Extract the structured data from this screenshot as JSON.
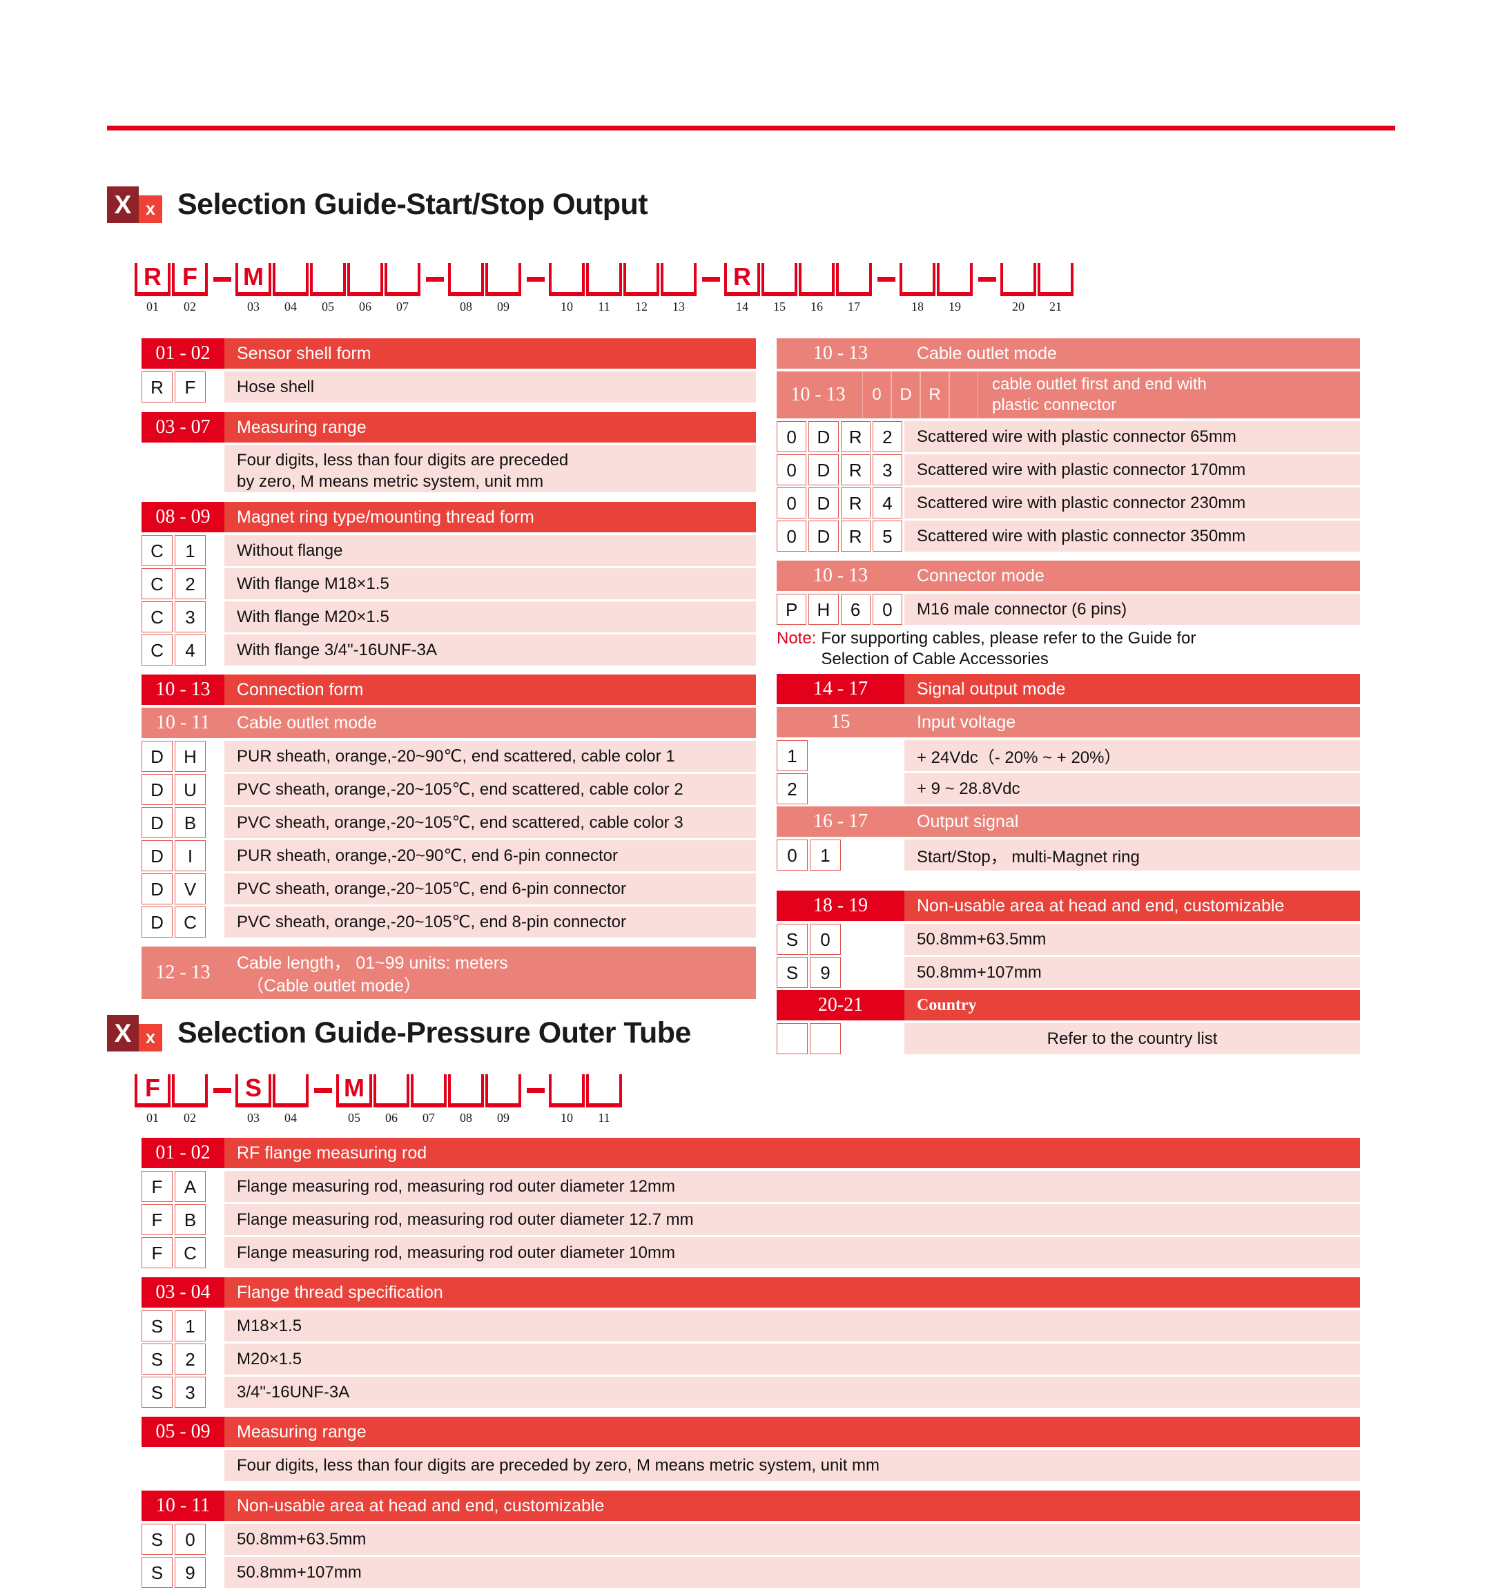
{
  "top_rule_color": "#e2001a",
  "logo": {
    "primary_letter": "X",
    "secondary_letter": "x",
    "primary_bg": "#8e2329",
    "secondary_bg": "#ef4136"
  },
  "section1": {
    "title": "Selection Guide-Start/Stop Output",
    "part_number": {
      "slots": [
        {
          "num": "01",
          "char": "R"
        },
        {
          "num": "02",
          "char": "F"
        },
        {
          "dash": true
        },
        {
          "num": "03",
          "char": "M"
        },
        {
          "num": "04",
          "char": ""
        },
        {
          "num": "05",
          "char": ""
        },
        {
          "num": "06",
          "char": ""
        },
        {
          "num": "07",
          "char": ""
        },
        {
          "dash": true
        },
        {
          "num": "08",
          "char": ""
        },
        {
          "num": "09",
          "char": ""
        },
        {
          "dash": true
        },
        {
          "num": "10",
          "char": ""
        },
        {
          "num": "11",
          "char": ""
        },
        {
          "num": "12",
          "char": ""
        },
        {
          "num": "13",
          "char": ""
        },
        {
          "dash": true
        },
        {
          "num": "14",
          "char": "R"
        },
        {
          "num": "15",
          "char": ""
        },
        {
          "num": "16",
          "char": ""
        },
        {
          "num": "17",
          "char": ""
        },
        {
          "dash": true
        },
        {
          "num": "18",
          "char": ""
        },
        {
          "num": "19",
          "char": ""
        },
        {
          "dash": true
        },
        {
          "num": "20",
          "char": ""
        },
        {
          "num": "21",
          "char": ""
        }
      ]
    },
    "left": {
      "g1": {
        "code": "01 - 02",
        "label": "Sensor shell form",
        "rows": [
          {
            "codes": [
              "R",
              "F"
            ],
            "desc": "Hose shell"
          }
        ]
      },
      "g2": {
        "code": "03 - 07",
        "label": "Measuring range",
        "desc_l1": "Four digits, less than four digits are preceded",
        "desc_l2": "by zero, M means metric system, unit mm"
      },
      "g3": {
        "code": "08 - 09",
        "label": "Magnet ring type/mounting thread form",
        "rows": [
          {
            "codes": [
              "C",
              "1"
            ],
            "desc": "Without flange"
          },
          {
            "codes": [
              "C",
              "2"
            ],
            "desc": "With flange   M18×1.5"
          },
          {
            "codes": [
              "C",
              "3"
            ],
            "desc": "With flange   M20×1.5"
          },
          {
            "codes": [
              "C",
              "4"
            ],
            "desc": "With flange   3/4\"-16UNF-3A"
          }
        ]
      },
      "g4": {
        "code": "10 - 13",
        "label": "Connection form",
        "sub_code": "10 - 11",
        "sub_label": "Cable outlet mode",
        "rows": [
          {
            "codes": [
              "D",
              "H"
            ],
            "desc": "PUR sheath, orange,-20~90℃, end scattered, cable color 1"
          },
          {
            "codes": [
              "D",
              "U"
            ],
            "desc": "PVC sheath, orange,-20~105℃, end scattered, cable color 2"
          },
          {
            "codes": [
              "D",
              "B"
            ],
            "desc": "PVC sheath, orange,-20~105℃, end scattered, cable color 3"
          },
          {
            "codes": [
              "D",
              "I"
            ],
            "desc": "PUR sheath, orange,-20~90℃, end 6-pin connector"
          },
          {
            "codes": [
              "D",
              "V"
            ],
            "desc": "PVC sheath, orange,-20~105℃, end 6-pin connector"
          },
          {
            "codes": [
              "D",
              "C"
            ],
            "desc": "PVC sheath, orange,-20~105℃, end 8-pin connector"
          }
        ]
      },
      "g5": {
        "code": "12 - 13",
        "label_l1": "Cable length， 01~99 units: meters",
        "label_l2": "（Cable outlet mode）"
      }
    },
    "right": {
      "g1": {
        "code": "10 - 13",
        "label": "Cable outlet mode",
        "sub_code": "10 - 13",
        "sub_boxes": [
          "0",
          "D",
          "R",
          ""
        ],
        "sub_desc_l1": "cable outlet first and end with",
        "sub_desc_l2": "plastic connector",
        "rows": [
          {
            "codes": [
              "0",
              "D",
              "R",
              "2"
            ],
            "desc": "Scattered wire with plastic connector 65mm"
          },
          {
            "codes": [
              "0",
              "D",
              "R",
              "3"
            ],
            "desc": "Scattered wire with plastic connector 170mm"
          },
          {
            "codes": [
              "0",
              "D",
              "R",
              "4"
            ],
            "desc": "Scattered wire with plastic connector 230mm"
          },
          {
            "codes": [
              "0",
              "D",
              "R",
              "5"
            ],
            "desc": "Scattered wire with plastic connector 350mm"
          }
        ]
      },
      "g2": {
        "code": "10 - 13",
        "label": "Connector mode",
        "rows": [
          {
            "codes": [
              "P",
              "H",
              "6",
              "0"
            ],
            "desc": "M16 male connector (6 pins)"
          }
        ]
      },
      "note": {
        "label": "Note:",
        "text_l1": "For supporting cables, please refer to the Guide for",
        "text_l2": "Selection of Cable Accessories"
      },
      "g3": {
        "code": "14 - 17",
        "label": "Signal output mode",
        "sub1_code": "15",
        "sub1_label": "Input voltage",
        "sub1_rows": [
          {
            "codes": [
              "1"
            ],
            "desc": "+ 24Vdc（- 20% ~ + 20%）"
          },
          {
            "codes": [
              "2"
            ],
            "desc": "+ 9 ~ 28.8Vdc"
          }
        ],
        "sub2_code": "16 - 17",
        "sub2_label": "Output signal",
        "sub2_rows": [
          {
            "codes": [
              "0",
              "1"
            ],
            "desc": "Start/Stop，  multi-Magnet ring"
          }
        ]
      },
      "g4": {
        "code": "18 - 19",
        "label": "Non-usable area at head and end, customizable",
        "rows": [
          {
            "codes": [
              "S",
              "0"
            ],
            "desc": "50.8mm+63.5mm"
          },
          {
            "codes": [
              "S",
              "9"
            ],
            "desc": "50.8mm+107mm"
          }
        ]
      },
      "g5": {
        "code": "20-21",
        "label": "Country",
        "rows": [
          {
            "codes": [
              "",
              ""
            ],
            "desc": "Refer to the country list"
          }
        ]
      }
    }
  },
  "section2": {
    "title": "Selection Guide-Pressure Outer Tube",
    "part_number": {
      "slots": [
        {
          "num": "01",
          "char": "F"
        },
        {
          "num": "02",
          "char": ""
        },
        {
          "dash": true
        },
        {
          "num": "03",
          "char": "S"
        },
        {
          "num": "04",
          "char": ""
        },
        {
          "dash": true
        },
        {
          "num": "05",
          "char": "M"
        },
        {
          "num": "06",
          "char": ""
        },
        {
          "num": "07",
          "char": ""
        },
        {
          "num": "08",
          "char": ""
        },
        {
          "num": "09",
          "char": ""
        },
        {
          "dash": true
        },
        {
          "num": "10",
          "char": ""
        },
        {
          "num": "11",
          "char": ""
        }
      ]
    },
    "g1": {
      "code": "01 - 02",
      "label": "RF flange measuring rod",
      "rows": [
        {
          "codes": [
            "F",
            "A"
          ],
          "desc": "Flange measuring rod, measuring rod outer diameter 12mm"
        },
        {
          "codes": [
            "F",
            "B"
          ],
          "desc": "Flange measuring rod, measuring rod outer diameter 12.7 mm"
        },
        {
          "codes": [
            "F",
            "C"
          ],
          "desc": "Flange measuring rod, measuring rod outer diameter 10mm"
        }
      ]
    },
    "g2": {
      "code": "03 - 04",
      "label": "Flange thread specification",
      "rows": [
        {
          "codes": [
            "S",
            "1"
          ],
          "desc": "M18×1.5"
        },
        {
          "codes": [
            "S",
            "2"
          ],
          "desc": "M20×1.5"
        },
        {
          "codes": [
            "S",
            "3"
          ],
          "desc": "3/4\"-16UNF-3A"
        }
      ]
    },
    "g3": {
      "code": "05 - 09",
      "label": "Measuring range",
      "desc": "Four digits, less than four digits are preceded by zero, M means metric system, unit mm"
    },
    "g4": {
      "code": "10 - 11",
      "label": "Non-usable area at head and end, customizable",
      "rows": [
        {
          "codes": [
            "S",
            "0"
          ],
          "desc": "50.8mm+63.5mm"
        },
        {
          "codes": [
            "S",
            "9"
          ],
          "desc": "50.8mm+107mm"
        }
      ]
    }
  }
}
